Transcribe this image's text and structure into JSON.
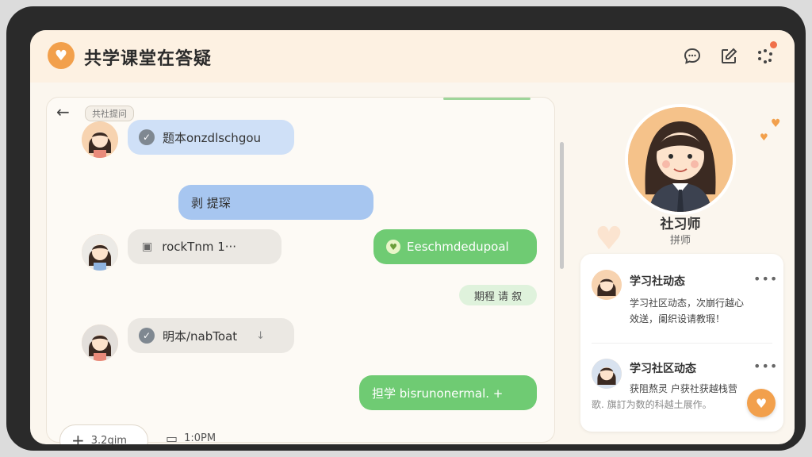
{
  "header": {
    "title": "共学课堂在答疑"
  },
  "chat": {
    "chip": "共社提问",
    "messages": [
      {
        "text": "题本onzdlschgou"
      },
      {
        "text": "剥 提琛"
      },
      {
        "text": "rockTnm 1···"
      },
      {
        "text": "Eeschmdedupoal"
      },
      {
        "text": "期程 请 叙"
      },
      {
        "text": "明本/nabToat"
      },
      {
        "text": "担学 bisrunonermal. +"
      }
    ],
    "add_label": "3.2gim",
    "time_label": "1:0PM"
  },
  "profile": {
    "name": "社习师",
    "role": "拼师"
  },
  "feed": {
    "items": [
      {
        "title": "学习社动态",
        "line1": "学习社区动态，次崩行越心",
        "line2": "效送，阑织设请教瑕！"
      },
      {
        "title": "学习社区动态",
        "line1": "获阻熬灵 户获社获越栈营",
        "line2": "歌. 旗訂为数的科越土展作。"
      }
    ]
  },
  "colors": {
    "accent": "#f2a04c",
    "green": "#6fcb73",
    "blue": "#a7c6f0"
  }
}
